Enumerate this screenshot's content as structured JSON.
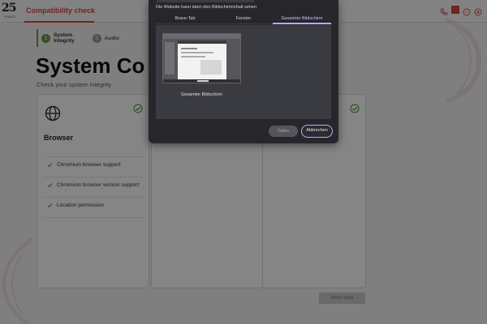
{
  "app": {
    "logo_number": "25",
    "logo_sub": "YEARS",
    "title": "Compatibility check",
    "accent": "#d9453f"
  },
  "stepper": {
    "steps": [
      {
        "number": "1",
        "label_line1": "System",
        "label_line2": "Integrity",
        "state": "active"
      },
      {
        "number": "2",
        "label_line1": "Audio",
        "label_line2": "",
        "state": "inactive"
      }
    ]
  },
  "page": {
    "title": "System Co",
    "subtitle": "Check your system integrity"
  },
  "card_browser": {
    "icon": "globe-icon",
    "title": "Browser",
    "status": "passed",
    "requirements": [
      "Chromium browser support",
      "Chromium browser version support",
      "Location permission"
    ]
  },
  "footer": {
    "next_label": "Next step"
  },
  "share_dialog": {
    "message": "Die Website kann dann den Bildschirminhalt sehen",
    "tabs": [
      "Brave-Tab",
      "Fenster",
      "Gesamter Bildschirm"
    ],
    "active_tab": "Gesamter Bildschirm",
    "screen_label": "Gesamter Bildschirm",
    "share_label": "Teilen",
    "cancel_label": "Abbrechen",
    "accent": "#b3adff"
  }
}
